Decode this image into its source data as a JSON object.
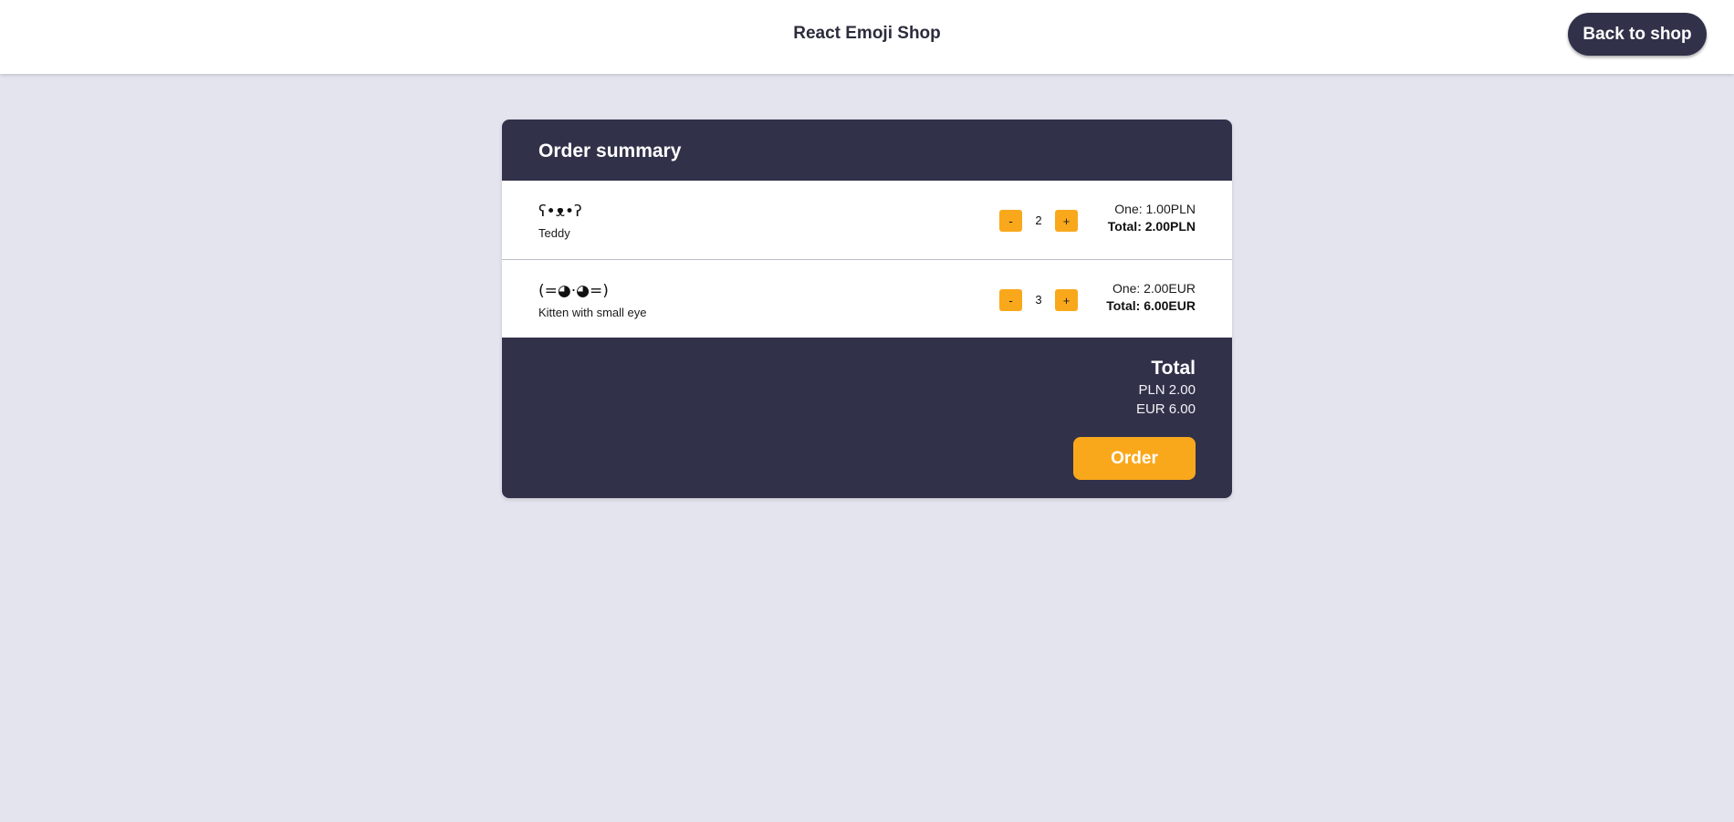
{
  "header": {
    "title": "React Emoji Shop",
    "back_label": "Back to shop"
  },
  "summary": {
    "title": "Order summary",
    "items": [
      {
        "emoji": "ʕ•ᴥ•ʔ",
        "name": "Teddy",
        "minus_label": "-",
        "plus_label": "+",
        "quantity": "2",
        "one_price": "One: 1.00PLN",
        "total_price": "Total: 2.00PLN"
      },
      {
        "emoji": "(=◕·◕=)",
        "name": "Kitten with small eye",
        "minus_label": "-",
        "plus_label": "+",
        "quantity": "3",
        "one_price": "One: 2.00EUR",
        "total_price": "Total: 6.00EUR"
      }
    ],
    "total_label": "Total",
    "totals": [
      "PLN 2.00",
      "EUR 6.00"
    ],
    "order_label": "Order"
  },
  "colors": {
    "dark": "#31314a",
    "accent": "#f9a81c",
    "background": "#e4e4ef"
  }
}
